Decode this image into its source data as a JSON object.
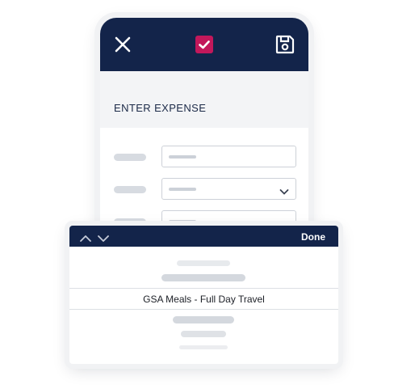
{
  "header": {
    "close_icon": "close-icon",
    "check_icon": "checkbox-checked-icon",
    "save_icon": "save-icon",
    "accent": "#c2185b",
    "bar_color": "#13244a"
  },
  "section": {
    "title": "ENTER EXPENSE"
  },
  "form": {
    "rows": [
      {
        "kind": "text-input"
      },
      {
        "kind": "dropdown",
        "icon": "chevron-down-icon"
      },
      {
        "kind": "dropdown",
        "icon": "chevron-down-icon"
      }
    ]
  },
  "picker": {
    "done_label": "Done",
    "prev_icon": "chevron-up-icon",
    "next_icon": "chevron-down-icon",
    "selected_option": "GSA Meals - Full Day Travel"
  }
}
